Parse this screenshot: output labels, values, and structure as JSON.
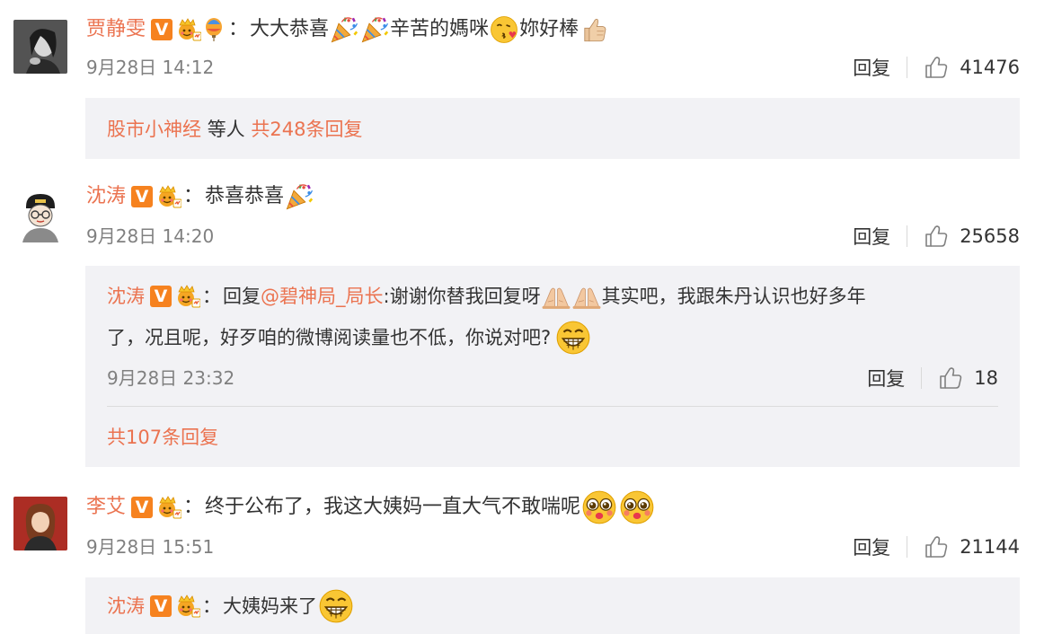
{
  "comments": [
    {
      "username": "贾静雯",
      "text_a": "大大恭喜",
      "text_b": "辛苦的媽咪",
      "text_c": "妳好棒",
      "time": "9月28日 14:12",
      "reply_label": "回复",
      "likes": "41476",
      "replies_summary": {
        "user": "股市小神经",
        "etc": "等人",
        "count": "共248条回复"
      }
    },
    {
      "username": "沈涛",
      "text_a": "恭喜恭喜",
      "time": "9月28日 14:20",
      "reply_label": "回复",
      "likes": "25658",
      "sub_reply": {
        "username": "沈涛",
        "prefix": "回复",
        "mention": "@碧神局_局长",
        "text_a": ":谢谢你替我回复呀",
        "text_b": "其实吧，我跟朱丹认识也好多年",
        "line2": "了，况且呢，好歹咱的微博阅读量也不低，你说对吧?",
        "time": "9月28日 23:32",
        "reply_label": "回复",
        "likes": "18"
      },
      "replies_count": "共107条回复"
    },
    {
      "username": "李艾",
      "text_a": "终于公布了，我这大姨妈一直大气不敢喘呢",
      "time": "9月28日 15:51",
      "reply_label": "回复",
      "likes": "21144",
      "sub_reply": {
        "username": "沈涛",
        "text_a": "大姨妈来了"
      }
    }
  ],
  "colon": "：",
  "verified_badge": "V",
  "colors": {
    "username": "#eb7350",
    "text": "#333333",
    "meta": "#808080",
    "reply_bg": "#f2f2f5",
    "badge": "#f6821f"
  },
  "icons": [
    "verified-v-icon",
    "crown-badge-icon",
    "balloon-icon",
    "party-popper-emoji",
    "kiss-emoji",
    "thumbs-up-emoji",
    "pray-emoji",
    "grin-emoji",
    "drool-emoji",
    "like-thumb-icon"
  ]
}
